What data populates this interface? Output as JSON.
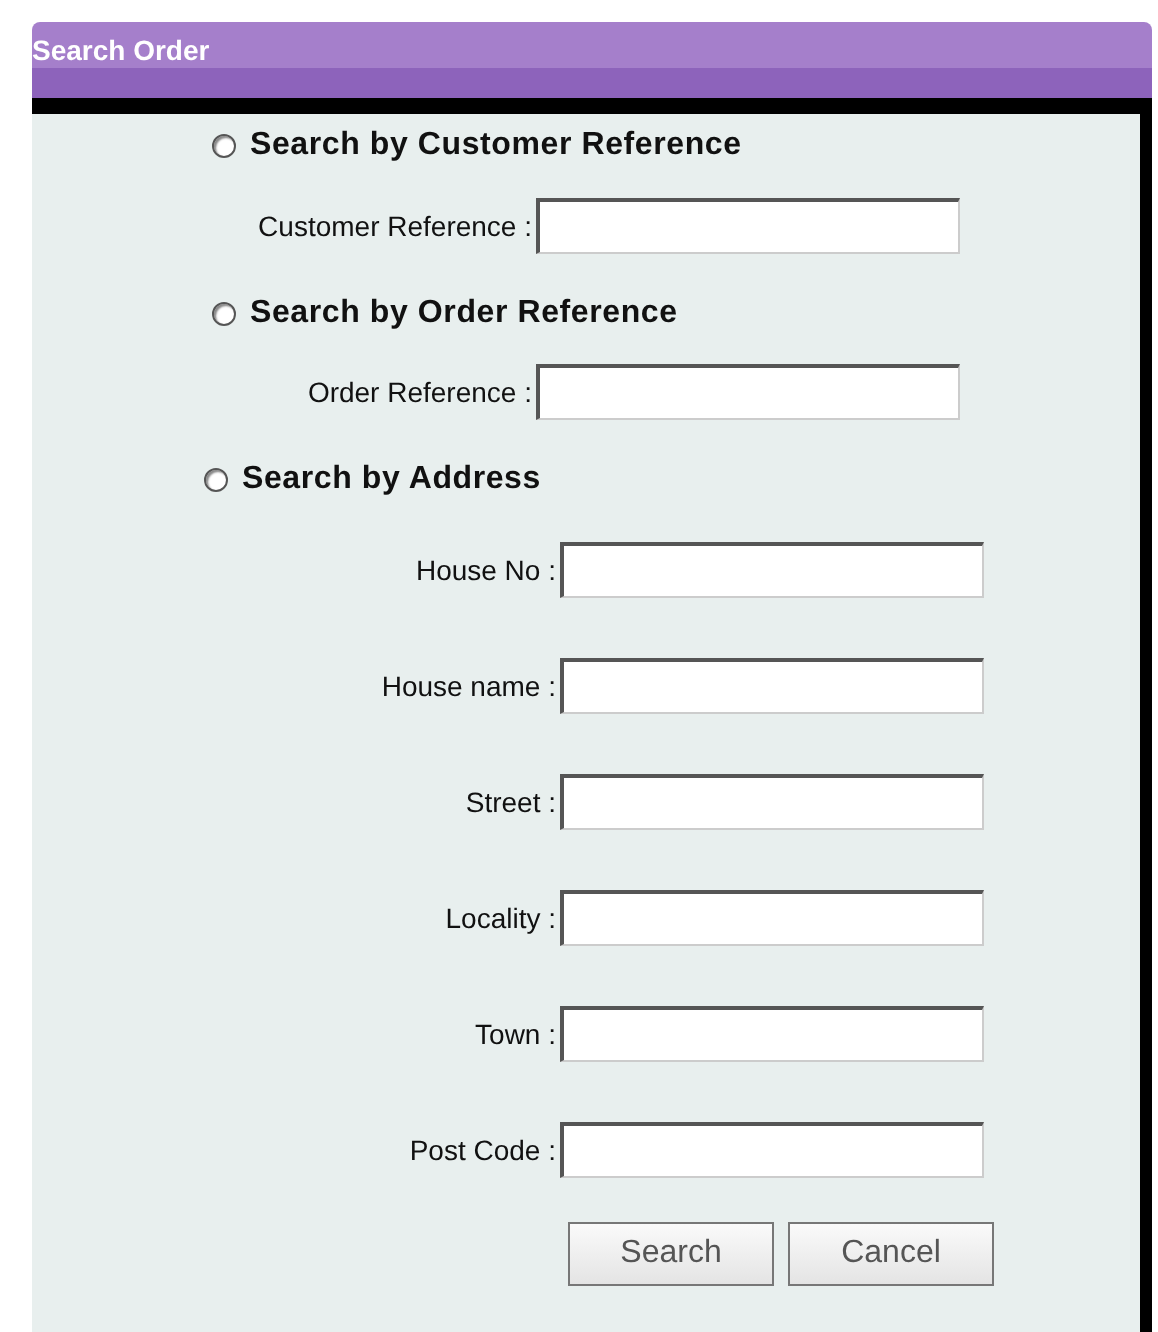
{
  "window": {
    "title": "Search Order"
  },
  "sections": [
    {
      "label": "Search by Customer Reference",
      "selected": false,
      "fields": [
        {
          "label": "Customer Reference :"
        }
      ]
    },
    {
      "label": "Search by Order Reference",
      "selected": false,
      "fields": [
        {
          "label": "Order Reference :"
        }
      ]
    },
    {
      "label": "Search by Address",
      "selected": false,
      "fields": [
        {
          "label": "House No :"
        },
        {
          "label": "House name :"
        },
        {
          "label": "Street :"
        },
        {
          "label": "Locality :"
        },
        {
          "label": "Town :"
        },
        {
          "label": "Post Code :"
        }
      ]
    }
  ],
  "buttons": [
    "Search",
    "Cancel"
  ]
}
